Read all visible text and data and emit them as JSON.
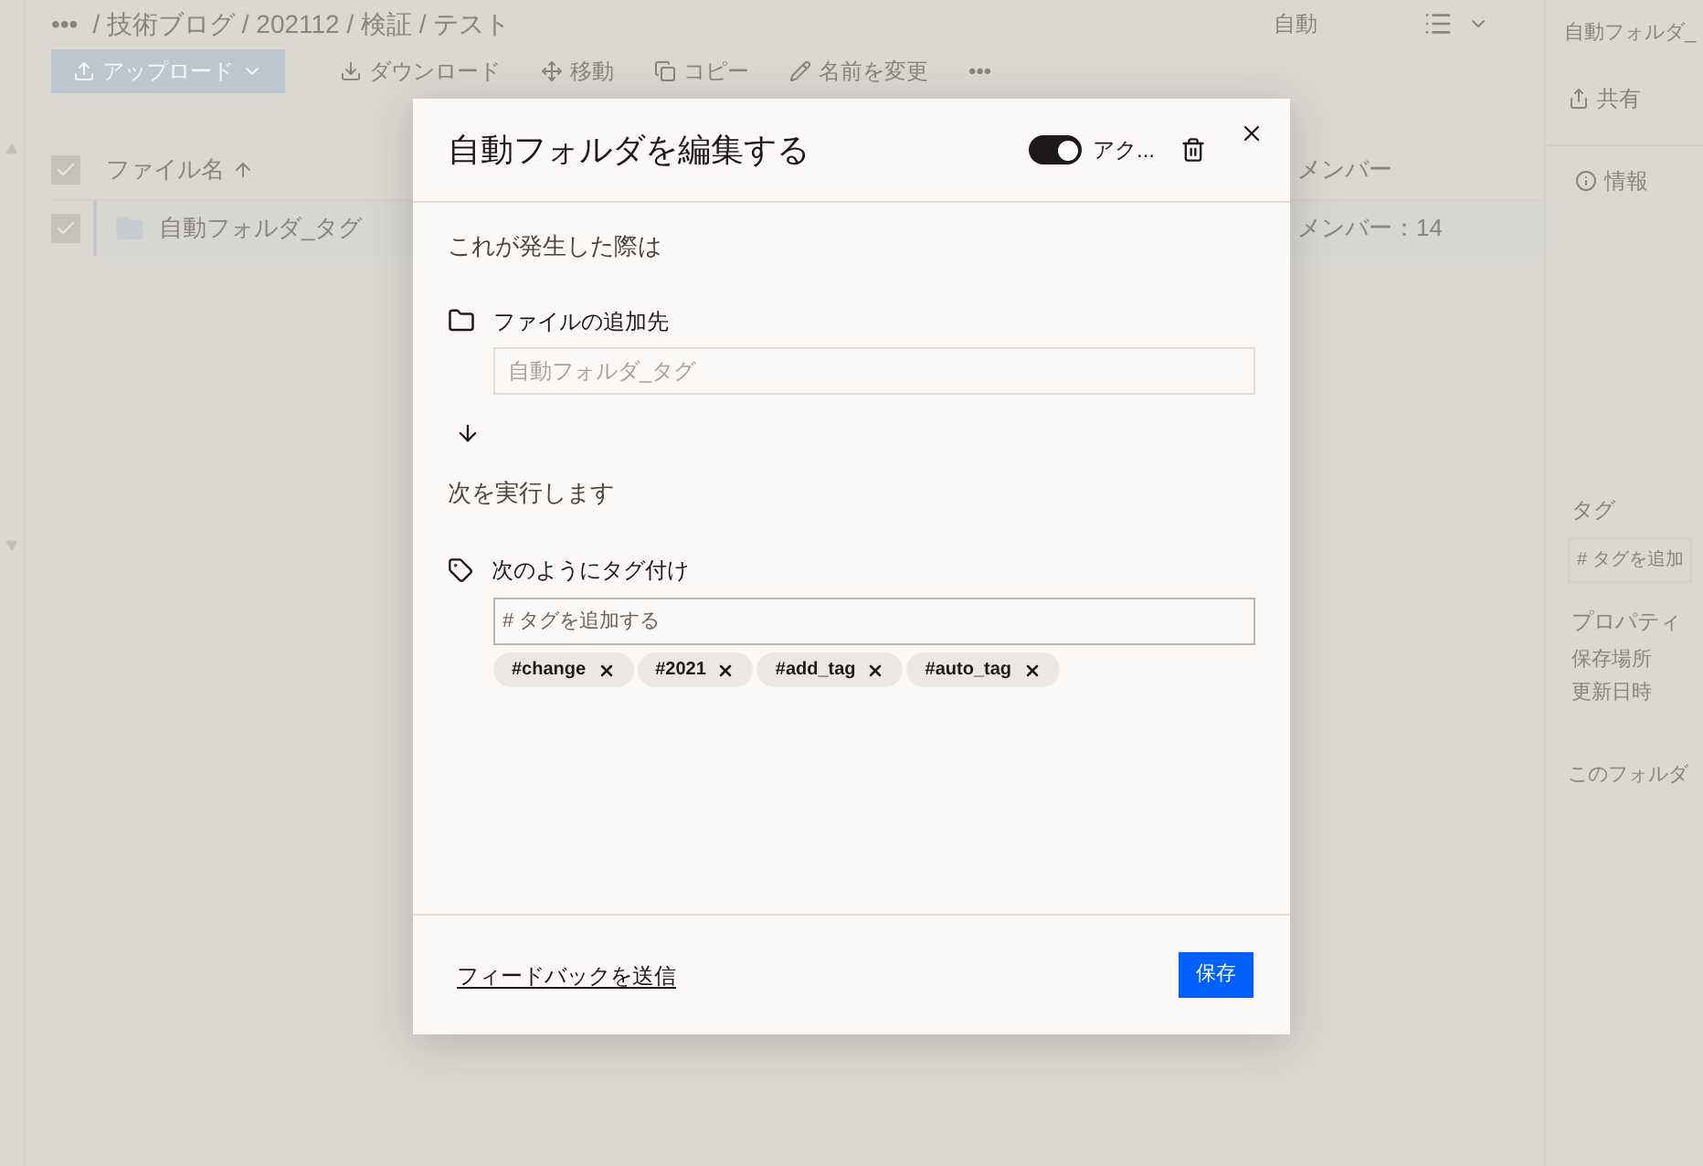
{
  "breadcrumb": {
    "more": "•••",
    "path": "/ 技術ブログ / 202112 / 検証 / テスト"
  },
  "header_right": {
    "sort": "自動"
  },
  "toolbar": [
    {
      "label": "アップロード",
      "kind": "primary"
    },
    {
      "label": "ダウンロード",
      "kind": "download"
    },
    {
      "label": "移動",
      "kind": "move"
    },
    {
      "label": "コピー",
      "kind": "copy"
    },
    {
      "label": "名前を変更",
      "kind": "rename"
    },
    {
      "label": "•••",
      "kind": "more"
    }
  ],
  "table": {
    "columns": [
      "ファイル名",
      "メンバー"
    ],
    "all_checked": true,
    "rows": [
      {
        "name": "自動フォルダ_タグ",
        "members": "メンバー：14",
        "selected": true
      }
    ]
  },
  "side_panel": {
    "title": "自動フォルダ_",
    "share": "共有",
    "info": "情報",
    "tags_label": "タグ",
    "tag_placeholder": "# タグを追加",
    "properties": "プロパティ",
    "location": "保存場所",
    "modified": "更新日時",
    "footer": "このフォルダ"
  },
  "dialog": {
    "title": "自動フォルダを編集する",
    "active": {
      "on": true,
      "label": "アク..."
    },
    "trigger_heading": "これが発生した際は",
    "destination_label": "ファイルの追加先",
    "destination_placeholder": "自動フォルダ_タグ",
    "action_heading": "次を実行します",
    "tag_label": "次のようにタグ付け",
    "tag_placeholder": "# タグを追加する",
    "tags": [
      "#change",
      "#2021",
      "#add_tag",
      "#auto_tag"
    ],
    "feedback": "フィードバックを送信",
    "save": "保存"
  }
}
